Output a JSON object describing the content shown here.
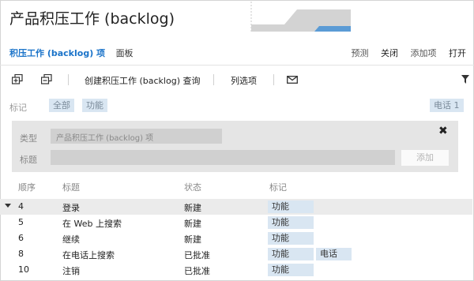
{
  "page": {
    "title": "产品积压工作 (backlog)"
  },
  "tabs": [
    {
      "label": "积压工作 (backlog) 项",
      "active": true
    },
    {
      "label": "面板",
      "active": false
    }
  ],
  "actions": [
    {
      "label": "预测"
    },
    {
      "label": "关闭"
    },
    {
      "label": "添加项"
    },
    {
      "label": "打开"
    }
  ],
  "toolbar": {
    "expand_icon": "expand-all-icon",
    "collapse_icon": "collapse-all-icon",
    "create_query_label": "创建积压工作 (backlog) 查询",
    "column_options_label": "列选项",
    "email_icon": "envelope-icon",
    "filter_icon": "filter-icon"
  },
  "tagbar": {
    "label": "标记",
    "chips": [
      "全部",
      "功能"
    ],
    "right_chip": "电话 1"
  },
  "add_panel": {
    "type_label": "类型",
    "type_value": "产品积压工作 (backlog) 项",
    "title_label": "标题",
    "title_value": "",
    "add_button": "添加",
    "close_icon": "close-icon"
  },
  "grid": {
    "columns": [
      "顺序",
      "标题",
      "状态",
      "标记"
    ],
    "rows": [
      {
        "order": "4",
        "title": "登录",
        "state": "新建",
        "tags": [
          "功能"
        ],
        "selected": true
      },
      {
        "order": "5",
        "title": "在 Web 上搜索",
        "state": "新建",
        "tags": [
          "功能"
        ],
        "selected": false
      },
      {
        "order": "6",
        "title": "继续",
        "state": "新建",
        "tags": [
          "功能"
        ],
        "selected": false
      },
      {
        "order": "8",
        "title": "在电话上搜索",
        "state": "已批准",
        "tags": [
          "功能",
          "电话"
        ],
        "selected": false
      },
      {
        "order": "10",
        "title": "注销",
        "state": "已批准",
        "tags": [
          "功能"
        ],
        "selected": false
      }
    ]
  },
  "colors": {
    "accent": "#1a73c9",
    "chip_bg": "#d9e6f2",
    "panel_bg": "#e5e5e5",
    "chart_gray": "#d3d3d3",
    "chart_blue": "#5b9bd5"
  }
}
